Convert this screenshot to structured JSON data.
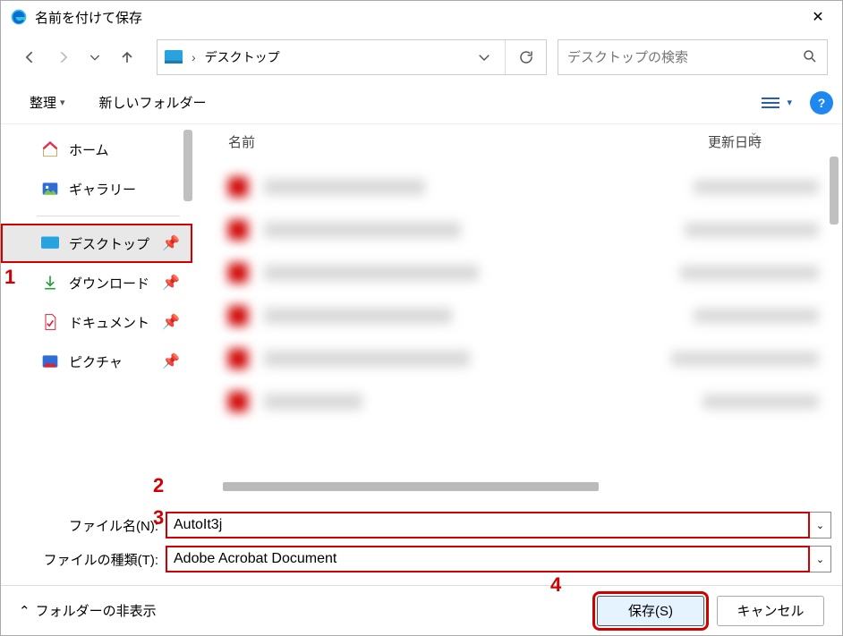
{
  "title": "名前を付けて保存",
  "nav": {
    "path": "デスクトップ"
  },
  "search": {
    "placeholder": "デスクトップの検索"
  },
  "toolbar": {
    "organize": "整理",
    "newFolder": "新しいフォルダー"
  },
  "sidebar": {
    "items": [
      {
        "label": "ホーム"
      },
      {
        "label": "ギャラリー"
      },
      {
        "label": "デスクトップ"
      },
      {
        "label": "ダウンロード"
      },
      {
        "label": "ドキュメント"
      },
      {
        "label": "ピクチャ"
      }
    ]
  },
  "headers": {
    "name": "名前",
    "date": "更新日時"
  },
  "form": {
    "filename_label": "ファイル名(N):",
    "filetype_label": "ファイルの種類(T):",
    "filename": "AutoIt3j",
    "filetype": "Adobe Acrobat Document"
  },
  "footer": {
    "hide": "フォルダーの非表示",
    "save": "保存(S)",
    "cancel": "キャンセル"
  },
  "markers": {
    "m1": "1",
    "m2": "2",
    "m3": "3",
    "m4": "4"
  }
}
